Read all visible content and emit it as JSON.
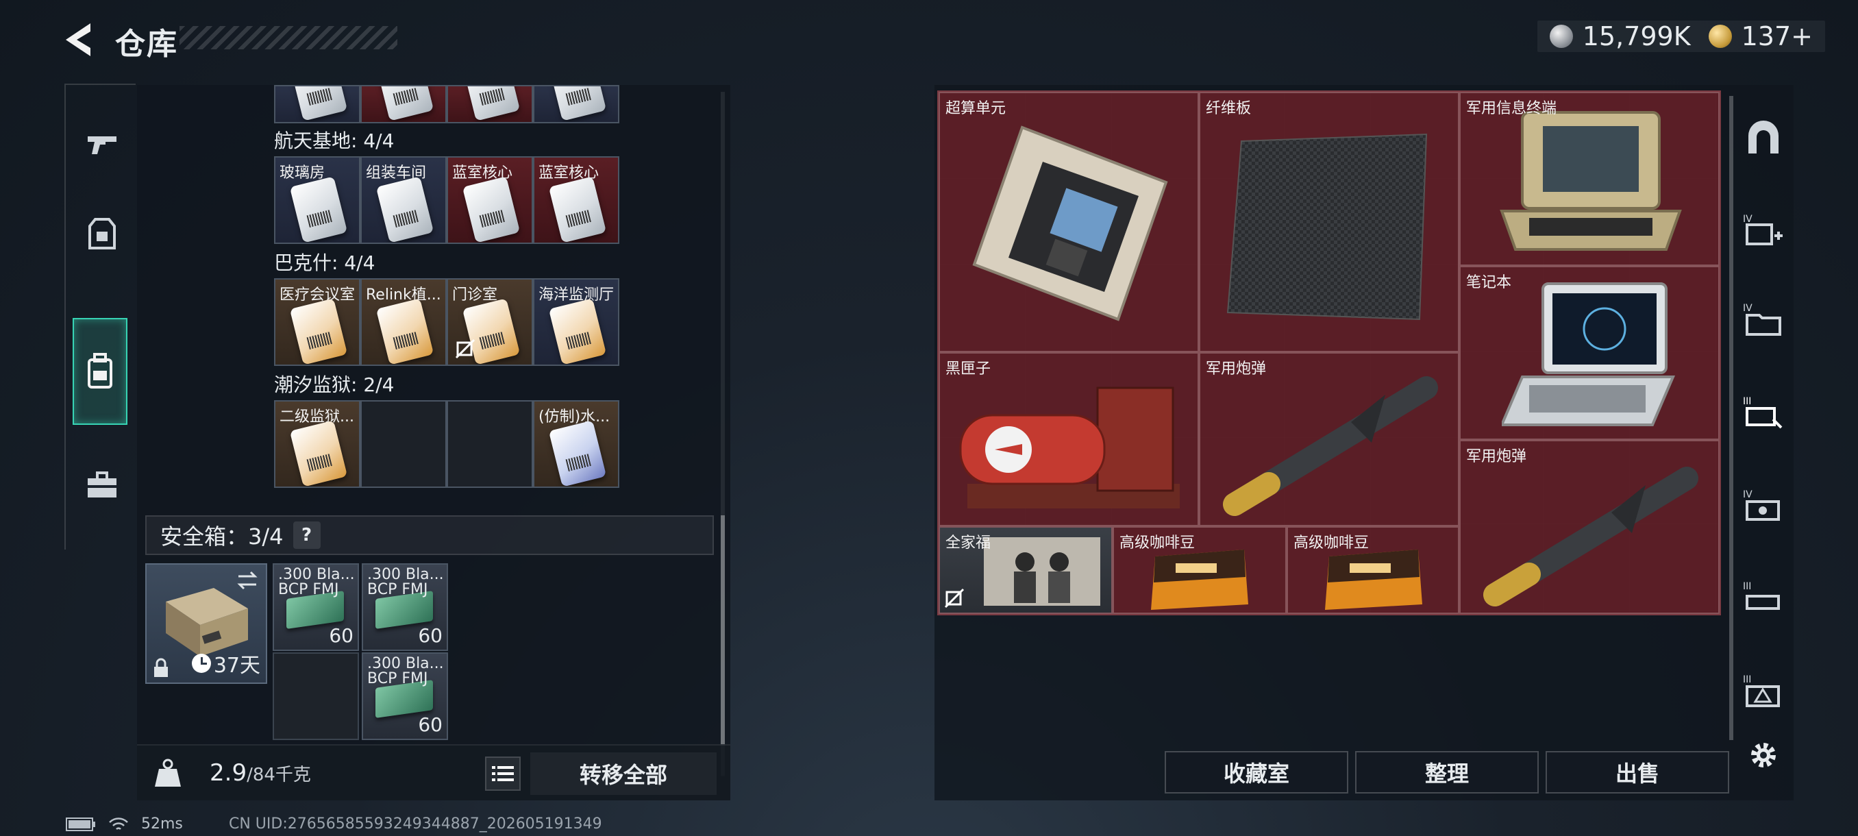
{
  "header": {
    "title": "仓库"
  },
  "currency": [
    {
      "value": "15,799K",
      "icon": "silver-coin-icon"
    },
    {
      "value": "137+",
      "icon": "gold-coin-icon"
    }
  ],
  "left": {
    "sections": [
      {
        "label": "航天基地: 4/4",
        "slots": [
          {
            "label": "玻璃房",
            "color": "blue"
          },
          {
            "label": "组装车间",
            "color": "blue"
          },
          {
            "label": "蓝室核心",
            "color": "red"
          },
          {
            "label": "蓝室核心",
            "color": "red"
          }
        ]
      },
      {
        "label": "巴克什: 4/4",
        "slots": [
          {
            "label": "医疗会议室",
            "color": "brown"
          },
          {
            "label": "Relink植...",
            "color": "brown"
          },
          {
            "label": "门诊室",
            "color": "brown"
          },
          {
            "label": "海洋监测厅",
            "color": "blue"
          }
        ]
      },
      {
        "label": "潮汐监狱: 2/4",
        "slots": [
          {
            "label": "二级监狱...",
            "color": "brown"
          },
          {
            "label": "",
            "color": "empty"
          },
          {
            "label": "",
            "color": "empty"
          },
          {
            "label": "(仿制)水...",
            "color": "brown"
          }
        ]
      }
    ],
    "safe_box": {
      "label": "安全箱：3/4",
      "help": "?",
      "days": "37天",
      "ammo": [
        {
          "name": ".300 Bla...",
          "type": "BCP FMJ",
          "qty": "60"
        },
        {
          "name": ".300 Bla...",
          "type": "BCP FMJ",
          "qty": "60"
        },
        {
          "name": ".300 Bla...",
          "type": "BCP FMJ",
          "qty": "60"
        }
      ]
    },
    "weight": {
      "current": "2.9",
      "max": "/84千克"
    },
    "transfer_all": "转移全部"
  },
  "stash": {
    "items": [
      {
        "label": "超算单元"
      },
      {
        "label": "纤维板"
      },
      {
        "label": "军用信息终端"
      },
      {
        "label": "笔记本"
      },
      {
        "label": "黑匣子"
      },
      {
        "label": "军用炮弹"
      },
      {
        "label": "军用炮弹"
      },
      {
        "label": "全家福"
      },
      {
        "label": "高级咖啡豆"
      },
      {
        "label": "高级咖啡豆"
      }
    ]
  },
  "actions": {
    "collection": "收藏室",
    "sort": "整理",
    "sell": "出售"
  },
  "status": {
    "ping": "52ms",
    "uid": "CN UID:27656585593249344887_202605191349"
  },
  "colors": {
    "accent": "#37d4b4",
    "stash_bg": "#5b2028"
  }
}
